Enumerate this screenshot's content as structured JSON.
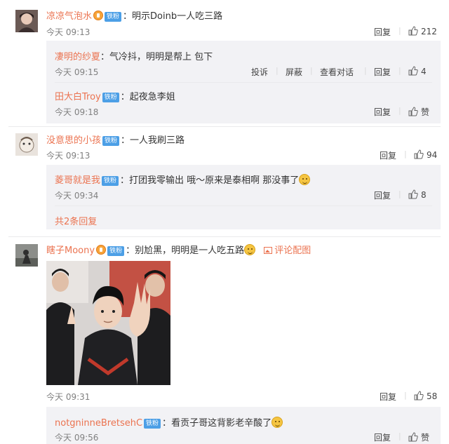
{
  "badge_label": "铁粉",
  "reply_label": "回复",
  "like_zan": "赞",
  "c1": {
    "user": "凉凉气泡水",
    "text": "明示Doinb一人吃三路",
    "time": "今天 09:13",
    "likes": "212",
    "replies": [
      {
        "user": "凄明的纱夏",
        "text": "气冷抖，明明是帮上 包下",
        "time": "今天 09:15",
        "likes": "4",
        "actions": [
          "投诉",
          "屏蔽",
          "查看对话"
        ]
      },
      {
        "user": "田大白Troy",
        "text": "起夜急李姐",
        "time": "今天 09:18",
        "likes": "赞"
      }
    ]
  },
  "c2": {
    "user": "没意思的小孩",
    "text": "一人我刷三路",
    "time": "今天 09:13",
    "likes": "94",
    "replies": [
      {
        "user": "菱哥就是我",
        "text": "打团我零输出 哦～原来是泰相啊 那没事了",
        "time": "今天 09:34",
        "likes": "8"
      }
    ],
    "more": "共2条回复"
  },
  "c3": {
    "user": "瞎子Moony",
    "text": "别尬黑，明明是一人吃五路",
    "pic_label": "评论配图",
    "time": "今天 09:31",
    "likes": "58",
    "replies": [
      {
        "user": "notgninneBretsehC",
        "text": "看贡子哥这背影老辛酸了",
        "time": "今天 09:56",
        "likes": "赞"
      }
    ]
  },
  "colors": {
    "username": "#eb7350",
    "badge": "#4c9fe6",
    "reply_bg": "#f2f2f5"
  }
}
